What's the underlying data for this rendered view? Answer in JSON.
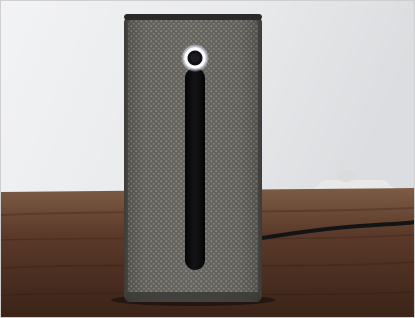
{
  "scene": {
    "subject": "speaker-device",
    "colors": {
      "wall": "#e9eaec",
      "table_dark": "#4a2f22",
      "table_light": "#7a5a45",
      "body": "#5e5c57",
      "body_highlight": "#8c8a83",
      "slot": "#0b0b0d",
      "ring_glow": "#ffffff",
      "top_edge": "#2b2a28"
    }
  }
}
